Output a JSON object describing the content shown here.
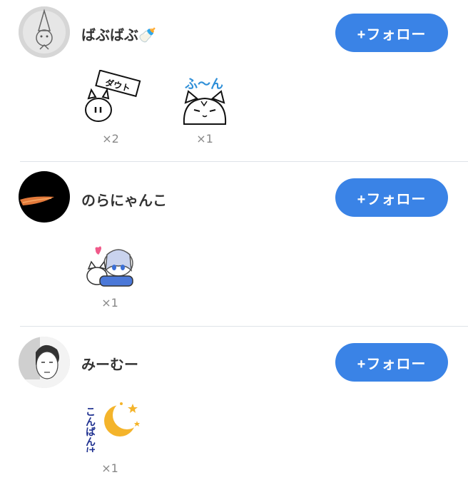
{
  "users": [
    {
      "name": "ばぶばぶ🍼",
      "follow_label": "+フォロー",
      "stickers": [
        {
          "text": "ダウト",
          "count": "×2"
        },
        {
          "text": "ふ〜ん",
          "count": "×1"
        }
      ]
    },
    {
      "name": "のらにゃんこ",
      "follow_label": "+フォロー",
      "stickers": [
        {
          "count": "×1"
        }
      ]
    },
    {
      "name": "みーむー",
      "follow_label": "+フォロー",
      "stickers": [
        {
          "text": "こんばんは",
          "count": "×1"
        }
      ]
    }
  ],
  "colors": {
    "accent": "#3a83e6",
    "divider": "#dfe3e8",
    "muted_text": "#888888"
  }
}
